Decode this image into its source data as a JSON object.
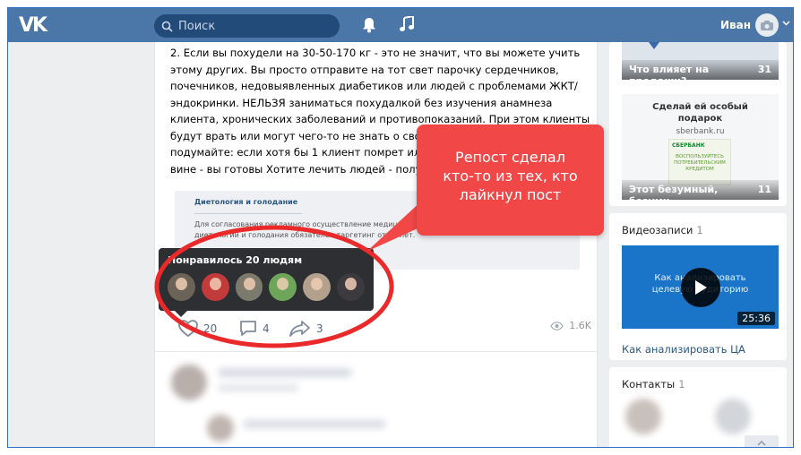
{
  "header": {
    "logo": "VK",
    "search_placeholder": "Поиск",
    "user_name": "Иван"
  },
  "post": {
    "text": "2. Если вы похудели на 30-50-170 кг - это не значит, что вы можете учить этому других. Вы просто отправите на тот свет парочку сердечников, почечников, недовыявленных диабетиков или людей с проблемами ЖКТ/эндокринки. НЕЛЬЗЯ заниматься похудалкой без изучения анамнеза клиента, хронических заболеваний и противопоказаний. При этом клиенты будут врать или могут чего-то не знать о своем здоровье. Хорошо подумайте: если хотя бы 1 клиент помрет или станет инвалидом по вашей вине - вы готовы Хотите лечить людей - получите мед. образование комплекс возможных последствий от вмешательс",
    "embed": {
      "title": "Диетология и голодание",
      "text": "Для согласования рекламного осуществление медицинской деятельно При рекламе услуг диетологии и голодания обязателен таргетинг от 18 лет."
    },
    "likes_tooltip": {
      "title": "Понравилось 20 людям",
      "avatar_colors": [
        "#6b6357",
        "#c23a3a",
        "#7b7a6c",
        "#6fa55b",
        "#b3a18d",
        "#3d3a3e"
      ]
    },
    "actions": {
      "likes": "20",
      "comments": "4",
      "shares": "3",
      "views": "1.6K"
    }
  },
  "callout": {
    "lines": [
      "Репост сделал",
      "кто-то из тех, кто",
      "лайкнул пост"
    ]
  },
  "sidebar": {
    "ad1": {
      "caption": "Что влияет на продажи?",
      "count": "31"
    },
    "ad2": {
      "title_line1": "Сделай ей особый",
      "title_line2": "подарок",
      "domain": "sberbank.ru",
      "card_brand": "СБЕРБАНК",
      "card_text": "ВОСПОЛЬЗУЙТЕСЬ ПОТРЕБИТЕЛЬСКИМ КРЕДИТОМ",
      "caption": "Этот безумный, безумн",
      "count": "11"
    },
    "videos": {
      "title": "Видеозаписи",
      "count": "1",
      "thumb_line1": "Как анализировать",
      "thumb_line2": "целевую аудиторию",
      "duration": "25:36",
      "link": "Как анализировать ЦА"
    },
    "contacts": {
      "title": "Контакты",
      "count": "1"
    }
  },
  "colors": {
    "header": "#4a76a8",
    "callout": "#f24747",
    "link": "#2a5885"
  }
}
